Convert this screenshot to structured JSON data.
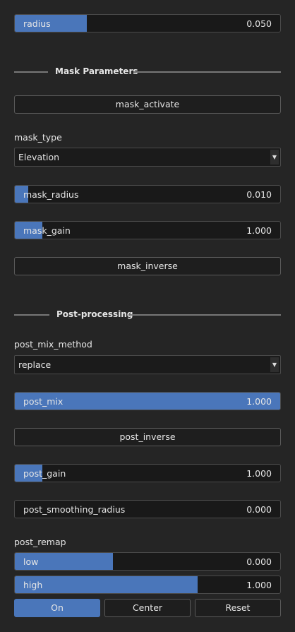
{
  "top": {
    "radius": {
      "label": "radius",
      "value": "0.050",
      "fraction": 0.27
    }
  },
  "mask_section": {
    "title": "Mask Parameters",
    "activate_label": "mask_activate",
    "type_label": "mask_type",
    "type_value": "Elevation",
    "mask_radius": {
      "label": "mask_radius",
      "value": "0.010",
      "fraction": 0.05
    },
    "mask_gain": {
      "label": "mask_gain",
      "value": "1.000",
      "fraction": 0.105
    },
    "inverse_label": "mask_inverse"
  },
  "post_section": {
    "title": "Post-processing",
    "mix_method_label": "post_mix_method",
    "mix_method_value": "replace",
    "post_mix": {
      "label": "post_mix",
      "value": "1.000",
      "fraction": 1.0
    },
    "inverse_label": "post_inverse",
    "post_gain": {
      "label": "post_gain",
      "value": "1.000",
      "fraction": 0.105
    },
    "post_smoothing_radius": {
      "label": "post_smoothing_radius",
      "value": "0.000",
      "fraction": 0.0
    },
    "remap_label": "post_remap",
    "low": {
      "label": "low",
      "value": "0.000",
      "fraction": 0.37
    },
    "high": {
      "label": "high",
      "value": "1.000",
      "fraction": 0.69
    },
    "buttons": {
      "on": "On",
      "center": "Center",
      "reset": "Reset"
    }
  },
  "colors": {
    "accent": "#4a76ba",
    "background": "#252525",
    "field": "#191919"
  },
  "icons": {
    "dropdown": "chevron-down-icon"
  }
}
